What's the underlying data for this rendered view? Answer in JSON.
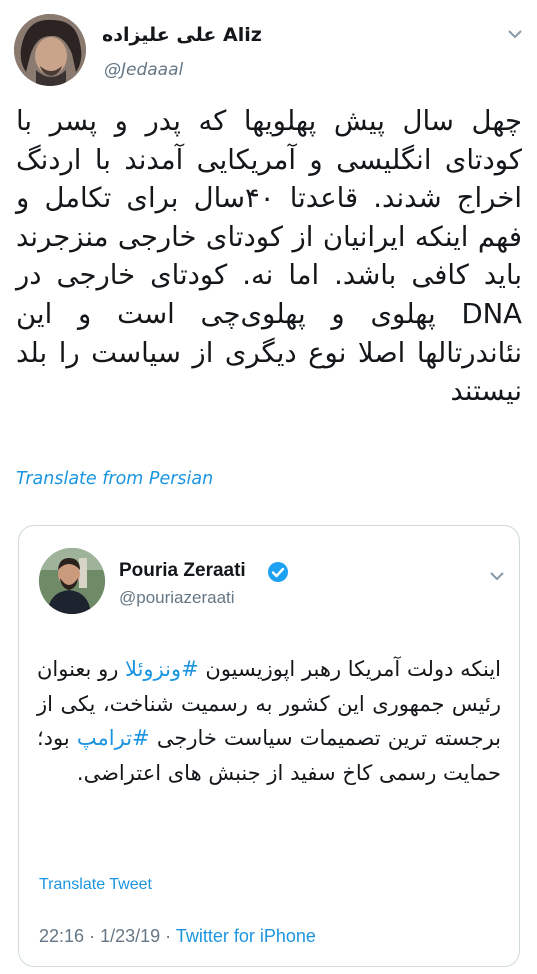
{
  "main_tweet": {
    "author_name": "علی علیزاده Aliz",
    "author_handle": "@Jedaaal",
    "text": "چهل سال پیش پهلویها که پدر و پسر با کودتای انگلیسی و آمریکایی آمدند با اردنگ اخراج شدند. قاعدتا ۴۰سال برای تکامل و فهم اینکه ایرانیان از کودتای خارجی منزجرند باید کافی باشد. اما نه. کودتای خارجی در DNA پهلوی و پهلوی‌چی است و این نئاندرتالها اصلا نوع دیگری از سیاست را بلد نیستند",
    "translate_label": "Translate from Persian"
  },
  "quoted_tweet": {
    "author_name": "Pouria Zeraati",
    "author_handle": "@pouriazeraati",
    "text_part1": "اینکه دولت آمریکا رهبر اپوزیسیون ",
    "hashtag1": "#ونزوئلا",
    "text_part2": " رو بعنوان رئیس جمهوری این کشور به رسمیت شناخت، یکی از برجسته ترین تصمیمات سیاست خارجی ",
    "hashtag2": "#ترامپ",
    "text_part3": " بود؛ حمایت رسمی کاخ سفید از جنبش های اعتراضی.",
    "translate_label": "Translate Tweet",
    "time": "22:16",
    "separator": "·",
    "date": "1/23/19",
    "source": "Twitter for iPhone"
  },
  "icons": {
    "verified": "verified-badge-icon",
    "more": "chevron-down-icon"
  },
  "colors": {
    "link": "#1b95e0",
    "secondary_text": "#657786",
    "border": "#cfd9de"
  }
}
